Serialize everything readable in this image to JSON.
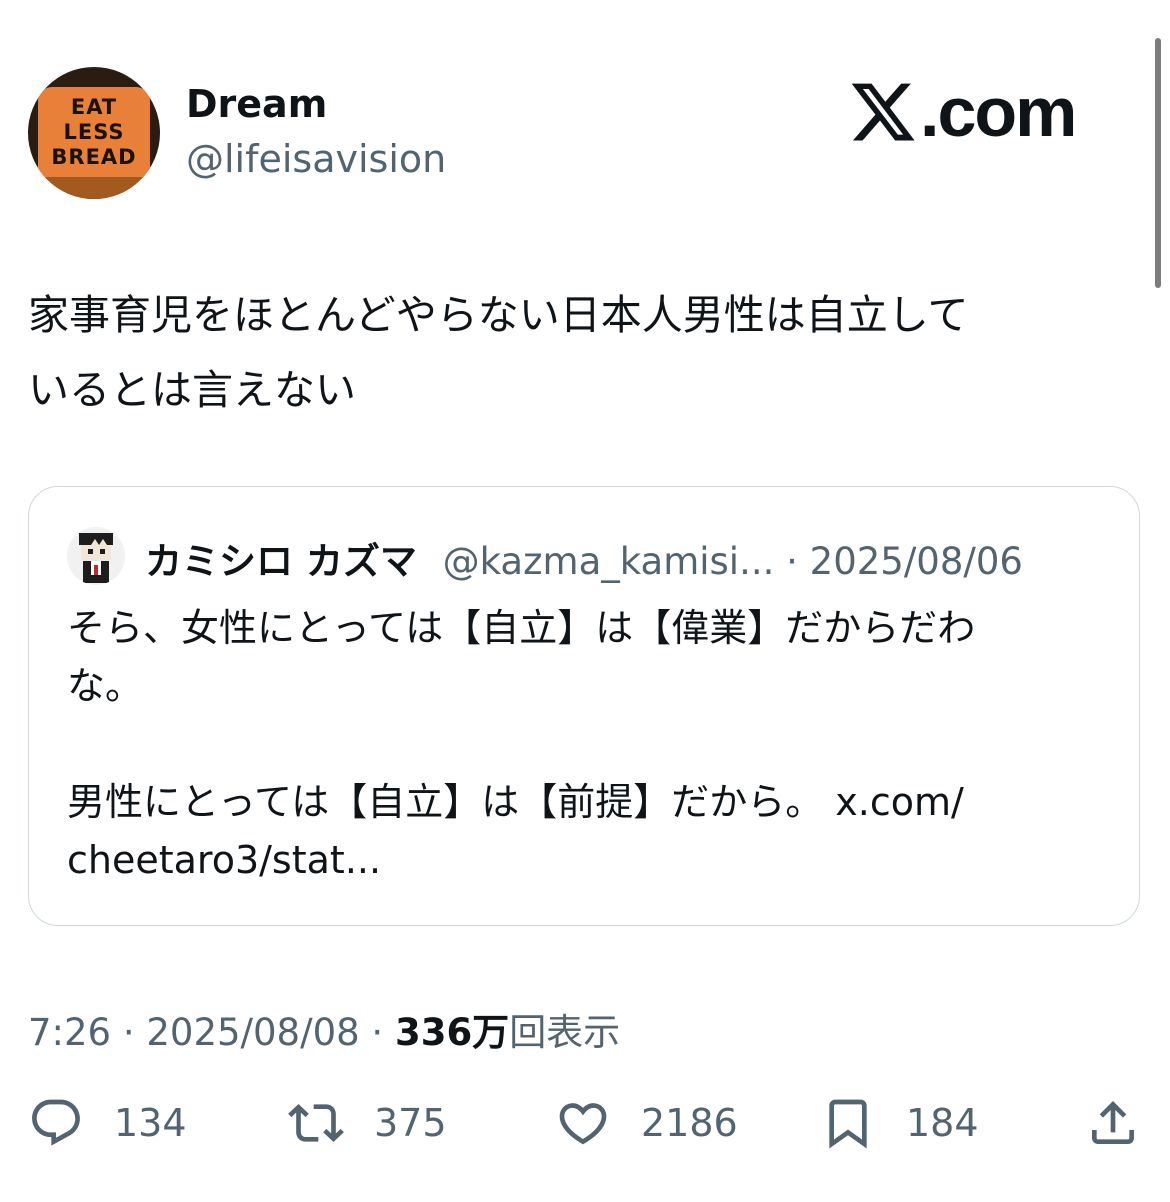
{
  "author": {
    "avatar_text": [
      "EAT",
      "LESS",
      "BREAD"
    ],
    "name": "Dream",
    "handle": "@lifeisavision"
  },
  "brand": {
    "logo_text": ".com"
  },
  "tweet": {
    "lines": [
      "家事育児をほとんどやらない日本人男性は自立して",
      "いるとは言えない"
    ]
  },
  "quote": {
    "name": "カミシロ カズマ",
    "handle": "@kazma_kamisi...",
    "separator": " · ",
    "date": "2025/08/06",
    "lines": [
      "そら、女性にとっては【自立】は【偉業】だからだわ",
      "な。"
    ],
    "lines2": [
      "男性にとっては【自立】は【前提】だから。 x.com/",
      "cheetaro3/stat..."
    ]
  },
  "meta": {
    "time": "7:26",
    "separator": " · ",
    "date": "2025/08/08",
    "views_number": "336万",
    "views_label": "回表示"
  },
  "actions": {
    "replies": "134",
    "reposts": "375",
    "likes": "2186",
    "bookmarks": "184"
  },
  "colors": {
    "text": "#0f1419",
    "secondary": "#536471",
    "border": "#cfd9de"
  }
}
